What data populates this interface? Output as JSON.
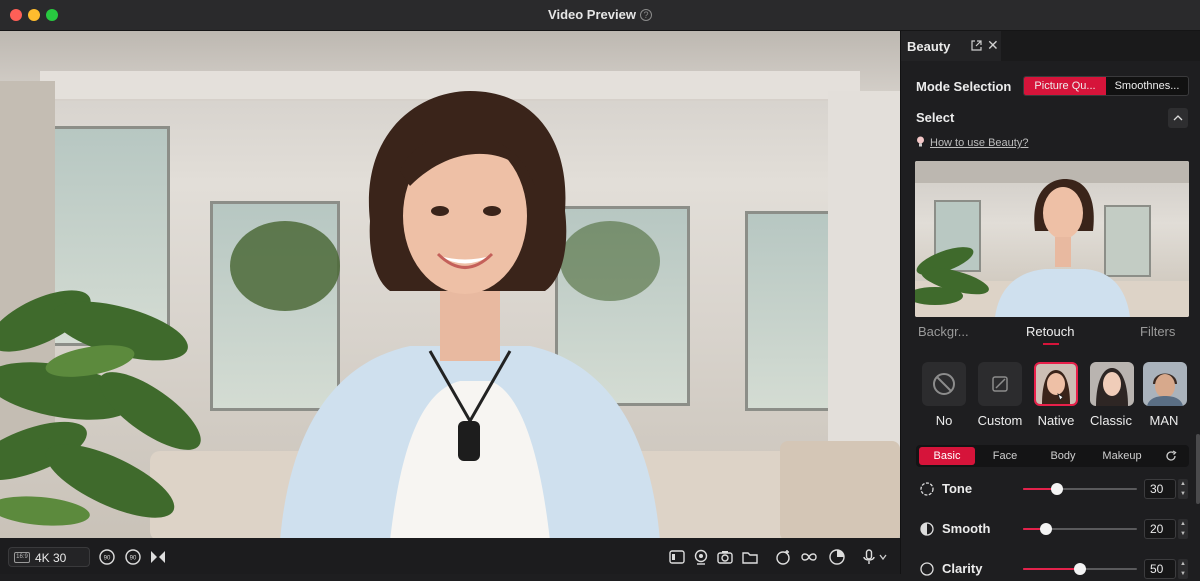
{
  "window": {
    "title": "Video Preview"
  },
  "toolbar": {
    "aspect_ratio": "16:9",
    "resolution": "4K 30"
  },
  "panel": {
    "tab_label": "Beauty",
    "mode_selection_label": "Mode Selection",
    "mode_options": [
      "Picture Qu...",
      "Smoothnes..."
    ],
    "select_label": "Select",
    "howto_link": "How to use Beauty?",
    "subtabs": [
      "Backgr...",
      "Retouch",
      "Filters"
    ],
    "presets": [
      "No",
      "Custom",
      "Native",
      "Classic",
      "MAN"
    ],
    "categories": [
      "Basic",
      "Face",
      "Body",
      "Makeup"
    ],
    "sliders": [
      {
        "label": "Tone",
        "value": "30",
        "level": 0.3
      },
      {
        "label": "Smooth",
        "value": "20",
        "level": 0.2
      },
      {
        "label": "Clarity",
        "value": "50",
        "level": 0.5
      }
    ]
  },
  "colors": {
    "accent": "#d6143a",
    "bg": "#1e1e20"
  }
}
